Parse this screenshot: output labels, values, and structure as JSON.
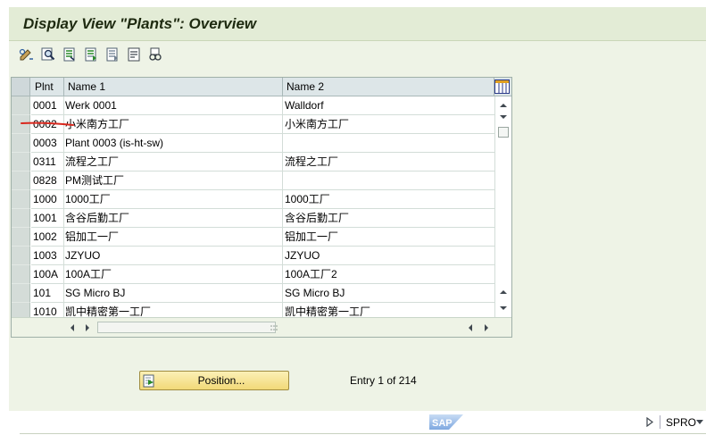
{
  "window": {
    "title": "Display View \"Plants\": Overview"
  },
  "toolbar": {
    "buttons": [
      {
        "name": "change-display-icon"
      },
      {
        "name": "details-icon"
      },
      {
        "name": "select-all-icon"
      },
      {
        "name": "select-block-icon"
      },
      {
        "name": "deselect-all-icon"
      },
      {
        "name": "print-icon"
      },
      {
        "name": "find-icon"
      }
    ]
  },
  "table": {
    "columns": [
      "Plnt",
      "Name 1",
      "Name 2"
    ],
    "rows": [
      {
        "plnt": "0001",
        "name1": "Werk 0001",
        "name2": "Walldorf"
      },
      {
        "plnt": "0002",
        "name1": "小米南方工厂",
        "name2": "小米南方工厂"
      },
      {
        "plnt": "0003",
        "name1": "Plant 0003 (is-ht-sw)",
        "name2": ""
      },
      {
        "plnt": "0311",
        "name1": "流程之工厂",
        "name2": "流程之工厂"
      },
      {
        "plnt": "0828",
        "name1": "PM测试工厂",
        "name2": ""
      },
      {
        "plnt": "1000",
        "name1": "1000工厂",
        "name2": "1000工厂"
      },
      {
        "plnt": "1001",
        "name1": "含谷后勤工厂",
        "name2": "含谷后勤工厂"
      },
      {
        "plnt": "1002",
        "name1": "铝加工一厂",
        "name2": "铝加工一厂"
      },
      {
        "plnt": "1003",
        "name1": "JZYUO",
        "name2": "JZYUO"
      },
      {
        "plnt": "100A",
        "name1": "100A工厂",
        "name2": "100A工厂2"
      },
      {
        "plnt": "101",
        "name1": "SG Micro BJ",
        "name2": "SG Micro BJ"
      },
      {
        "plnt": "1010",
        "name1": "凯中精密第一工厂",
        "name2": "凯中精密第一工厂"
      }
    ]
  },
  "footer": {
    "position_label": "Position...",
    "entry_text": "Entry 1 of 214"
  },
  "status": {
    "logo": "SAP",
    "system": "SPRO"
  },
  "colors": {
    "annotation": "#d9281e",
    "button_bg": "#f2d978"
  }
}
